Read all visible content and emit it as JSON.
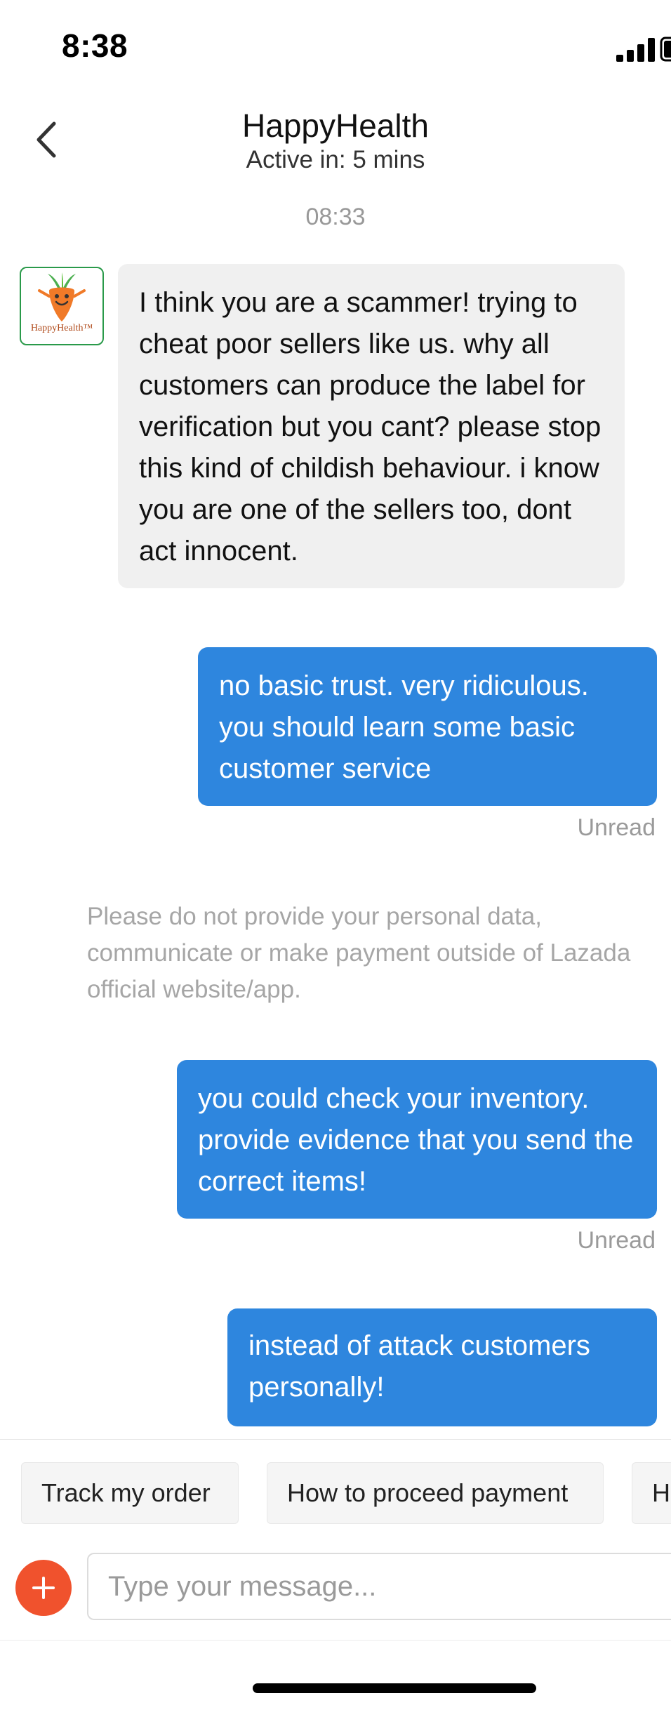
{
  "status_bar": {
    "time": "8:38",
    "icons": [
      "signal-icon",
      "battery-icon"
    ]
  },
  "header": {
    "title": "HappyHealth",
    "subtitle": "Active in: 5 mins",
    "back_icon": "chevron-left-icon"
  },
  "chat": {
    "timestamp": "08:33",
    "avatar": {
      "icon": "carrot-mascot-logo",
      "brand_text": "HappyHealth™"
    },
    "messages": [
      {
        "sender": "seller",
        "text": "I think you are a scammer! trying to cheat poor sellers like us. why all customers can produce the label for verification but you cant? please stop this kind of childish behaviour. i know you are one of the sellers too, dont act innocent."
      },
      {
        "sender": "me",
        "text": "no basic trust. very ridiculous. you should learn some basic customer service",
        "status": "Unread"
      },
      {
        "sender": "me",
        "text": "you could check your inventory. provide evidence that you send the correct items!",
        "status": "Unread"
      },
      {
        "sender": "me",
        "text": "instead of attack customers personally!"
      }
    ],
    "system_notice": {
      "line1": "Please do not provide your personal data,",
      "line2": "communicate or make payment outside of Lazada",
      "line3": "official website/app."
    }
  },
  "quick_replies": [
    "Track my order",
    "How to proceed payment",
    "How"
  ],
  "input": {
    "placeholder": "Type your message...",
    "value": "",
    "add_icon": "plus-icon"
  },
  "colors": {
    "outgoing_bubble": "#2e86de",
    "incoming_bubble": "#f0f0f0",
    "add_button": "#f0522d"
  }
}
